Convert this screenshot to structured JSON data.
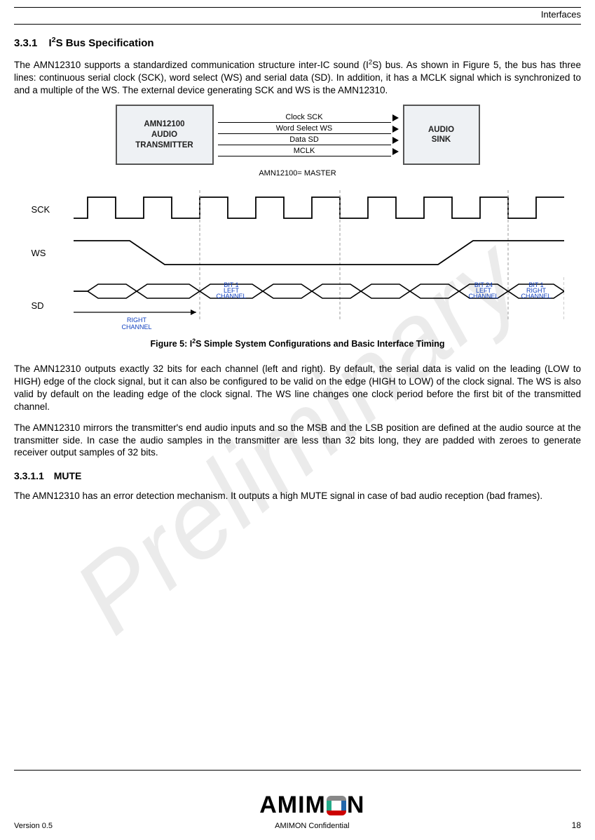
{
  "header": {
    "section": "Interfaces"
  },
  "section": {
    "number": "3.3.1",
    "title_pre": "I",
    "title_sup": "2",
    "title_post": "S Bus Specification"
  },
  "para1": "The AMN12310 supports a standardized communication structure inter-IC sound (I",
  "para1_sup": "2",
  "para1_tail": "S) bus. As shown in Figure 5, the bus has three lines: continuous serial clock (SCK), word select (WS) and serial data (SD). In addition, it has a MCLK signal which is synchronized to and a multiple of the WS. The external device generating SCK and WS is the AMN12310.",
  "block": {
    "tx_line1": "AMN12100",
    "tx_line2": "AUDIO",
    "tx_line3": "TRANSMITTER",
    "sig1": "Clock SCK",
    "sig2": "Word Select WS",
    "sig3": "Data SD",
    "sig4": "MCLK",
    "sink_line1": "AUDIO",
    "sink_line2": "SINK",
    "master_note": "AMN12100= MASTER"
  },
  "timing": {
    "sck": "SCK",
    "ws": "WS",
    "sd": "SD",
    "right_ch": "RIGHT",
    "right_ch2": "CHANNEL",
    "bit1l_a": "BIT 1",
    "bit1l_b": "LEFT",
    "bit1l_c": "CHANNEL",
    "bit24_a": "BIT 24",
    "bit24_b": "LEFT",
    "bit24_c": "CHANNEL",
    "bit1r_a": "BIT 1",
    "bit1r_b": "RIGHT",
    "bit1r_c": "CHANNEL"
  },
  "figcap_pre": "Figure 5: I",
  "figcap_sup": "2",
  "figcap_post": "S Simple System Configurations and Basic Interface Timing",
  "para2": "The AMN12310 outputs exactly 32 bits for each channel (left and right). By default, the serial data is valid on the leading (LOW to HIGH) edge of the clock signal, but it can also be configured to be valid on the edge (HIGH to LOW) of the clock signal. The WS is also valid by default on the leading edge of the clock signal. The WS line changes one clock period before the first bit of the transmitted channel.",
  "para3": "The AMN12310 mirrors the transmitter's end audio inputs and so the MSB and the LSB position are defined at the audio source at the transmitter side. In case the audio samples in the transmitter are less than 32 bits long, they are padded with zeroes to generate receiver output samples of 32 bits.",
  "sub": {
    "number": "3.3.1.1",
    "title": "MUTE"
  },
  "para4": "The AMN12310 has an error detection mechanism. It outputs a high MUTE signal in case of bad audio reception (bad frames).",
  "watermark": "Preliminary",
  "footer": {
    "version": "Version 0.5",
    "logo_text_pre": "AMIM",
    "logo_text_post": "N",
    "confidential": "AMIMON Confidential",
    "page": "18"
  }
}
